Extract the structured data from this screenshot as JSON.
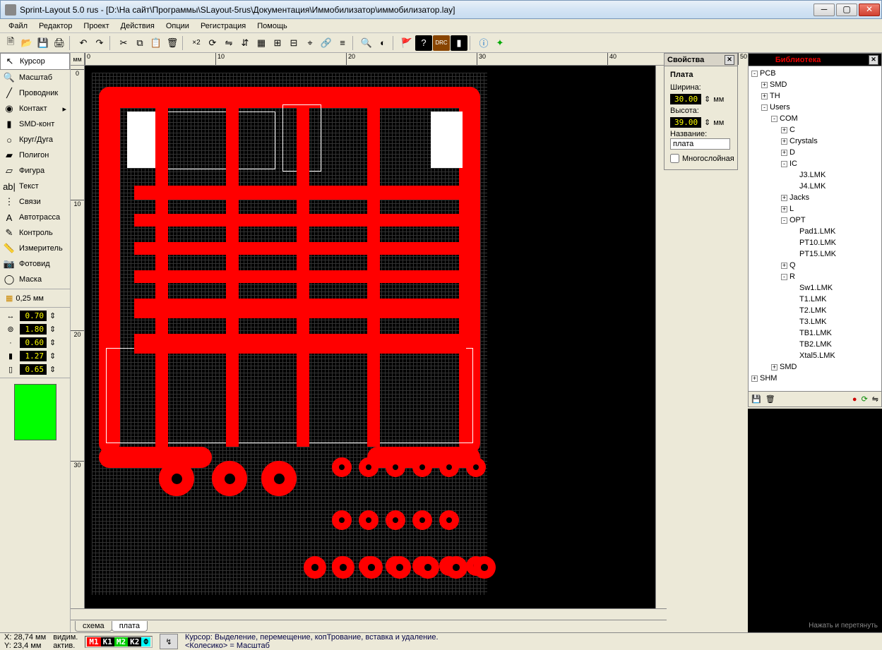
{
  "title": "Sprint-Layout 5.0 rus    - [D:\\На сайт\\Программы\\SLayout-5rus\\Документация\\Иммобилизатор\\иммобилизатор.lay]",
  "menu": [
    "Файл",
    "Редактор",
    "Проект",
    "Действия",
    "Опции",
    "Регистрация",
    "Помощь"
  ],
  "tools": [
    {
      "icon": "↖",
      "label": "Курсор",
      "sel": true
    },
    {
      "icon": "🔍",
      "label": "Масштаб"
    },
    {
      "icon": "╱",
      "label": "Проводник"
    },
    {
      "icon": "◉",
      "label": "Контакт",
      "arrow": true
    },
    {
      "icon": "▮",
      "label": "SMD-конт"
    },
    {
      "icon": "○",
      "label": "Круг/Дуга"
    },
    {
      "icon": "▰",
      "label": "Полигон"
    },
    {
      "icon": "▱",
      "label": "Фигура"
    },
    {
      "icon": "ab|",
      "label": "Текст"
    },
    {
      "icon": "⋮",
      "label": "Связи"
    },
    {
      "icon": "A",
      "label": "Автотрасса"
    },
    {
      "icon": "✎",
      "label": "Контроль"
    },
    {
      "icon": "📏",
      "label": "Измеритель"
    },
    {
      "icon": "📷",
      "label": "Фотовид"
    },
    {
      "icon": "◯",
      "label": "Маска"
    }
  ],
  "grid_label": "0,25 мм",
  "params": [
    {
      "icon": "↔",
      "val": "0.70"
    },
    {
      "icon": "⊚",
      "val": "1.80"
    },
    {
      "icon": "·",
      "val": "0.60"
    },
    {
      "icon": "▮",
      "val": "1.27"
    },
    {
      "icon": "▯",
      "val": "0.65"
    }
  ],
  "ruler_unit": "мм",
  "ruler_h": [
    "0",
    "10",
    "20",
    "30",
    "40",
    "50"
  ],
  "ruler_v": [
    "0",
    "10",
    "20",
    "30"
  ],
  "tabs": [
    "схема",
    "плата"
  ],
  "props": {
    "hdr": "Свойства",
    "title": "Плата",
    "width_lbl": "Ширина:",
    "width_val": "30.00",
    "unit": "мм",
    "height_lbl": "Высота:",
    "height_val": "39.00",
    "name_lbl": "Название:",
    "name_val": "плата",
    "multi_lbl": "Многослойная"
  },
  "lib": {
    "hdr": "Библиотека",
    "tree": [
      {
        "d": 0,
        "b": "-",
        "t": "PCB"
      },
      {
        "d": 1,
        "b": "+",
        "t": "SMD"
      },
      {
        "d": 1,
        "b": "+",
        "t": "TH"
      },
      {
        "d": 1,
        "b": "-",
        "t": "Users"
      },
      {
        "d": 2,
        "b": "-",
        "t": "COM"
      },
      {
        "d": 3,
        "b": "+",
        "t": "C"
      },
      {
        "d": 3,
        "b": "+",
        "t": "Crystals"
      },
      {
        "d": 3,
        "b": "+",
        "t": "D"
      },
      {
        "d": 3,
        "b": "-",
        "t": "IC"
      },
      {
        "d": 4,
        "b": "",
        "t": "J3.LMK"
      },
      {
        "d": 4,
        "b": "",
        "t": "J4.LMK"
      },
      {
        "d": 3,
        "b": "+",
        "t": "Jacks"
      },
      {
        "d": 3,
        "b": "+",
        "t": "L"
      },
      {
        "d": 3,
        "b": "-",
        "t": "OPT"
      },
      {
        "d": 4,
        "b": "",
        "t": "Pad1.LMK"
      },
      {
        "d": 4,
        "b": "",
        "t": "PT10.LMK"
      },
      {
        "d": 4,
        "b": "",
        "t": "PT15.LMK"
      },
      {
        "d": 3,
        "b": "+",
        "t": "Q"
      },
      {
        "d": 3,
        "b": "-",
        "t": "R"
      },
      {
        "d": 4,
        "b": "",
        "t": "Sw1.LMK"
      },
      {
        "d": 4,
        "b": "",
        "t": "T1.LMK"
      },
      {
        "d": 4,
        "b": "",
        "t": "T2.LMK"
      },
      {
        "d": 4,
        "b": "",
        "t": "T3.LMK"
      },
      {
        "d": 4,
        "b": "",
        "t": "TB1.LMK"
      },
      {
        "d": 4,
        "b": "",
        "t": "TB2.LMK"
      },
      {
        "d": 4,
        "b": "",
        "t": "Xtal5.LMK"
      },
      {
        "d": 2,
        "b": "+",
        "t": "SMD"
      },
      {
        "d": 0,
        "b": "+",
        "t": "SHM"
      }
    ],
    "preview_hint": "Нажать и перетянуть"
  },
  "status": {
    "x_lbl": "X:",
    "x": "28,74 мм",
    "y_lbl": "Y:",
    "y": "23,4 мм",
    "vis": "видим.",
    "act": "актив.",
    "layers": [
      {
        "t": "М1",
        "c": "#f00"
      },
      {
        "t": "К1",
        "c": "#000"
      },
      {
        "t": "М2",
        "c": "#0c0"
      },
      {
        "t": "К2",
        "c": "#000"
      },
      {
        "t": "Ф",
        "c": "#0ff",
        "fg": "#000"
      }
    ],
    "msg1": "Курсор: Выделение, перемещение, копТрование, вставка и удаление.",
    "msg2": "<Колесико> = Масштаб"
  }
}
